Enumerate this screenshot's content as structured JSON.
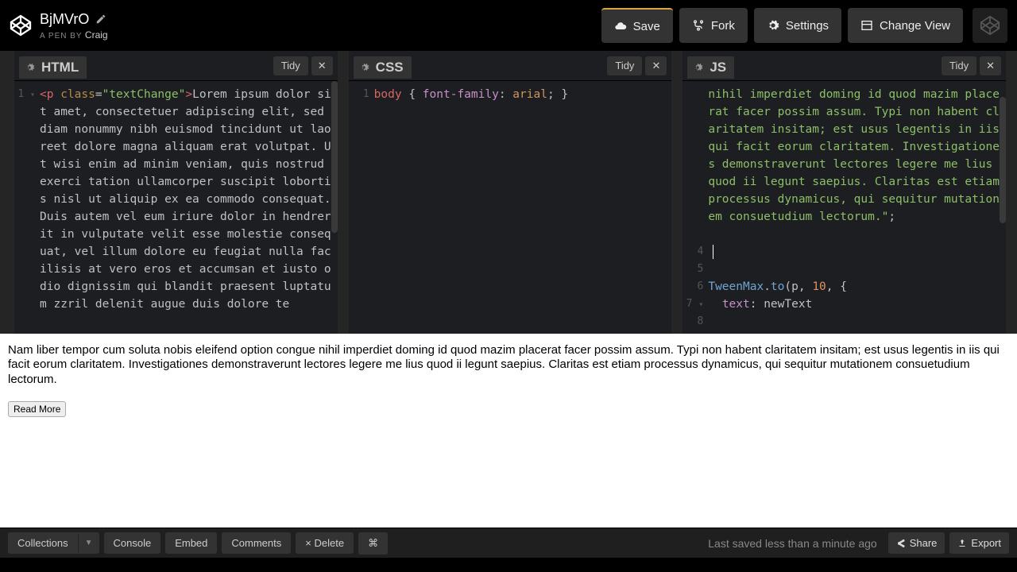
{
  "header": {
    "pen_title": "BjMVrO",
    "sub_prefix": "A PEN BY",
    "author": "Craig",
    "buttons": {
      "save": "Save",
      "fork": "Fork",
      "settings": "Settings",
      "change_view": "Change View"
    }
  },
  "panes": {
    "html": {
      "title": "HTML",
      "tidy": "Tidy"
    },
    "css": {
      "title": "CSS",
      "tidy": "Tidy"
    },
    "js": {
      "title": "JS",
      "tidy": "Tidy"
    }
  },
  "html_code": {
    "line_no": "1",
    "tag_open": "<p",
    "attr_name": "class",
    "eq": "=",
    "attr_val": "\"textChange\"",
    "gt": ">",
    "text": "Lorem ipsum dolor sit amet, consectetuer adipiscing elit, sed diam nonummy nibh euismod tincidunt ut laoreet dolore magna aliquam erat volutpat. Ut wisi enim ad minim veniam, quis nostrud exerci tation ullamcorper suscipit lobortis nisl ut aliquip ex ea commodo consequat. Duis autem vel eum iriure dolor in hendrerit in vulputate velit esse molestie consequat, vel illum dolore eu feugiat nulla facilisis at vero eros et accumsan et iusto odio dignissim qui blandit praesent luptatum zzril delenit augue duis dolore te"
  },
  "css_code": {
    "line_no": "1",
    "selector": "body",
    "brace_o": " { ",
    "prop": "font-family",
    "colon": ": ",
    "val": "arial",
    "semi": "; ",
    "brace_c": "}"
  },
  "js_code": {
    "string_tail": "nihil imperdiet doming id quod mazim placerat facer possim assum. Typi non habent claritatem insitam; est usus legentis in iis qui facit eorum claritatem. Investigationes demonstraverunt lectores legere me lius quod ii legunt saepius. Claritas est etiam processus dynamicus, qui sequitur mutationem consuetudium lectorum.\"",
    "semi": ";",
    "lines": {
      "l4": "4",
      "l5": "5",
      "l6": "6",
      "l7": "7",
      "l8": "8"
    },
    "tw_obj": "TweenMax",
    "dot": ".",
    "tw_fn": "to",
    "paren_o": "(",
    "arg1": "p",
    "comma": ", ",
    "arg2": "10",
    "tail": ", {",
    "key": "text",
    "colon": ": ",
    "val": "newText"
  },
  "preview": {
    "paragraph": "Nam liber tempor cum soluta nobis eleifend option congue nihil imperdiet doming id quod mazim placerat facer possim assum. Typi non habent claritatem insitam; est usus legentis in iis qui facit eorum claritatem. Investigationes demonstraverunt lectores legere me lius quod ii legunt saepius. Claritas est etiam processus dynamicus, qui sequitur mutationem consuetudium lectorum.",
    "button": "Read More"
  },
  "footer": {
    "collections": "Collections",
    "console": "Console",
    "embed": "Embed",
    "comments": "Comments",
    "delete": "× Delete",
    "cmd": "⌘",
    "status": "Last saved less than a minute ago",
    "share": "Share",
    "export": "Export"
  }
}
